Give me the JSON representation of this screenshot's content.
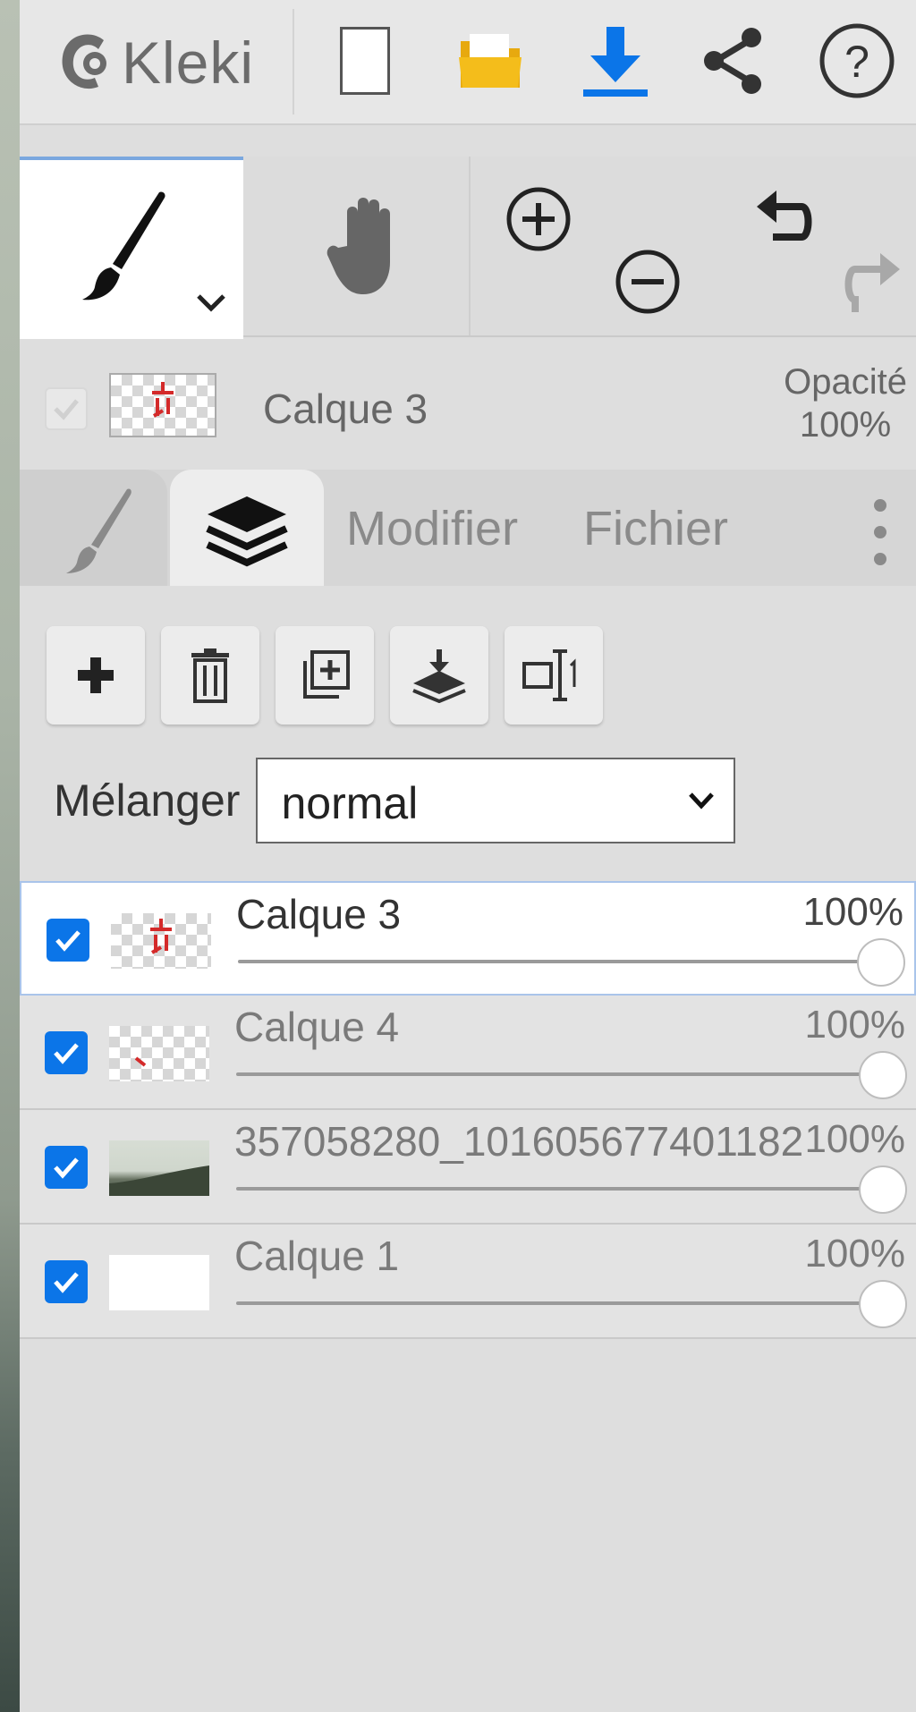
{
  "app": {
    "name": "Kleki"
  },
  "topbar": {
    "icons": [
      "new-image-icon",
      "open-folder-icon",
      "download-icon",
      "share-icon",
      "help-icon"
    ],
    "colors": {
      "folder": "#f2b917",
      "download": "#0b75e8"
    }
  },
  "tools": {
    "active": "brush",
    "items": [
      "brush-tool",
      "hand-tool",
      "zoom-in",
      "zoom-out",
      "undo",
      "redo"
    ]
  },
  "current_layer": {
    "name": "Calque 3",
    "opacity_label": "Opacité",
    "opacity_value": "100%"
  },
  "tabs": [
    {
      "id": "brush",
      "label": ""
    },
    {
      "id": "layers",
      "label": "",
      "active": true
    },
    {
      "id": "edit",
      "label": "Modifier"
    },
    {
      "id": "file",
      "label": "Fichier"
    }
  ],
  "layer_toolbar": [
    "add-layer",
    "delete-layer",
    "duplicate-layer",
    "merge-down",
    "rename-layer"
  ],
  "blend": {
    "label": "Mélanger",
    "value": "normal"
  },
  "layers": [
    {
      "name": "Calque 3",
      "opacity": "100%",
      "checked": true,
      "active": true,
      "thumb": "checker-red"
    },
    {
      "name": "Calque 4",
      "opacity": "100%",
      "checked": true,
      "active": false,
      "thumb": "checker-small"
    },
    {
      "name": "357058280_101605677401182",
      "opacity": "100%",
      "checked": true,
      "active": false,
      "thumb": "photo"
    },
    {
      "name": "Calque 1",
      "opacity": "100%",
      "checked": true,
      "active": false,
      "thumb": "white"
    }
  ]
}
